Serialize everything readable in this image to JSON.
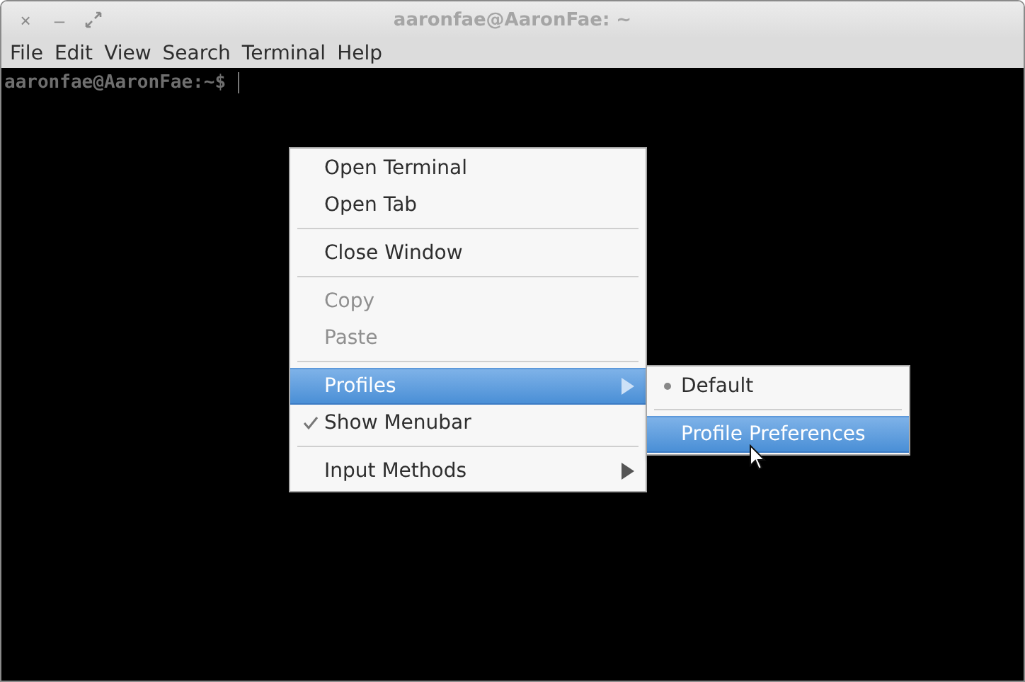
{
  "window": {
    "title": "aaronfae@AaronFae: ~",
    "controls": [
      "×",
      "–"
    ]
  },
  "menubar": [
    "File",
    "Edit",
    "View",
    "Search",
    "Terminal",
    "Help"
  ],
  "terminal": {
    "prompt": "aaronfae@AaronFae:~$"
  },
  "context_menu": {
    "groups": [
      [
        {
          "label": "Open Terminal",
          "disabled": false,
          "selected": false,
          "checked": false,
          "submenu": false
        },
        {
          "label": "Open Tab",
          "disabled": false,
          "selected": false,
          "checked": false,
          "submenu": false
        }
      ],
      [
        {
          "label": "Close Window",
          "disabled": false,
          "selected": false,
          "checked": false,
          "submenu": false
        }
      ],
      [
        {
          "label": "Copy",
          "disabled": true,
          "selected": false,
          "checked": false,
          "submenu": false
        },
        {
          "label": "Paste",
          "disabled": true,
          "selected": false,
          "checked": false,
          "submenu": false
        }
      ],
      [
        {
          "label": "Profiles",
          "disabled": false,
          "selected": true,
          "checked": false,
          "submenu": true
        },
        {
          "label": "Show Menubar",
          "disabled": false,
          "selected": false,
          "checked": true,
          "submenu": false
        }
      ],
      [
        {
          "label": "Input Methods",
          "disabled": false,
          "selected": false,
          "checked": false,
          "submenu": true
        }
      ]
    ]
  },
  "profiles_submenu": {
    "groups": [
      [
        {
          "label": "Default",
          "disabled": false,
          "selected": false,
          "active": true
        }
      ],
      [
        {
          "label": "Profile Preferences",
          "disabled": false,
          "selected": true,
          "active": false
        }
      ]
    ]
  }
}
